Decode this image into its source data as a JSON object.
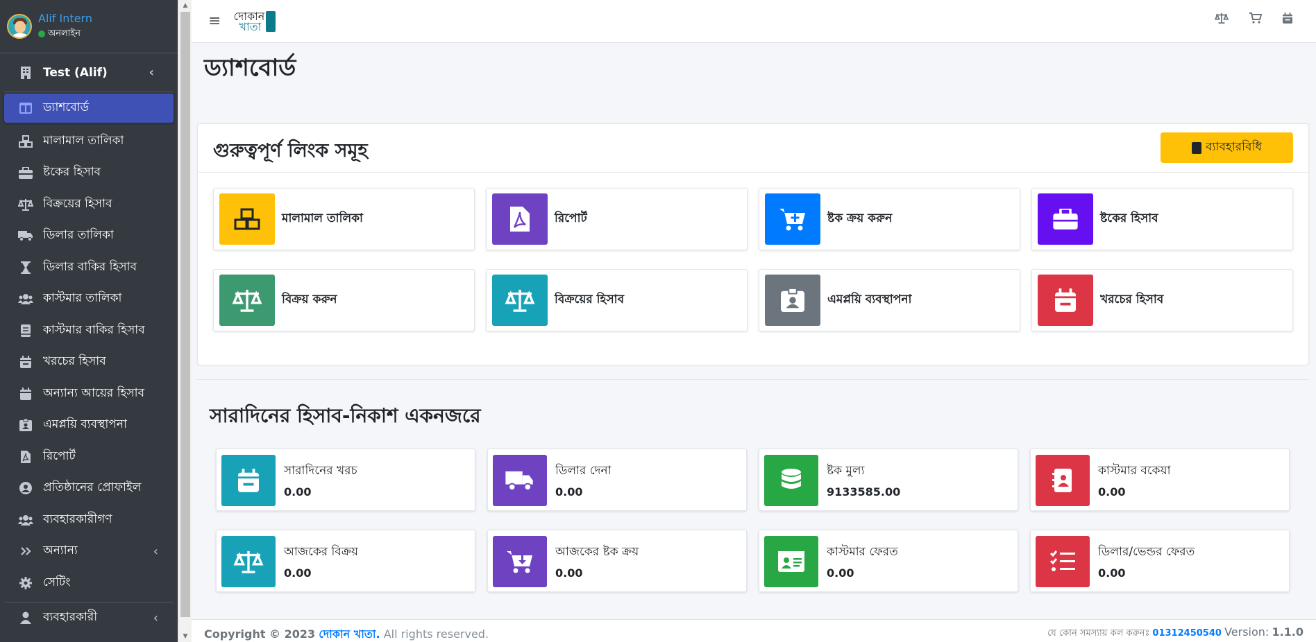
{
  "user": {
    "name": "Alif Intern",
    "status": "অনলাইন"
  },
  "sidebar": {
    "company": "Test (Alif)",
    "items": [
      {
        "label": "ড্যাশবোর্ড",
        "icon": "dashboard-icon"
      },
      {
        "label": "মালামাল তালিকা",
        "icon": "cubes-icon"
      },
      {
        "label": "ষ্টকের হিসাব",
        "icon": "briefcase-icon"
      },
      {
        "label": "বিক্রয়ের হিসাব",
        "icon": "scale-icon"
      },
      {
        "label": "ডিলার তালিকা",
        "icon": "truck-icon"
      },
      {
        "label": "ডিলার বাকির হিসাব",
        "icon": "hourglass-icon"
      },
      {
        "label": "কাস্টমার তালিকা",
        "icon": "users-icon"
      },
      {
        "label": "কাস্টমার বাকির হিসাব",
        "icon": "book-icon"
      },
      {
        "label": "খরচের হিসাব",
        "icon": "calendar-minus-icon"
      },
      {
        "label": "অন্যান্য আয়ের হিসাব",
        "icon": "calendar-icon"
      },
      {
        "label": "এমপ্লয়ি ব্যবস্থাপনা",
        "icon": "id-badge-icon"
      },
      {
        "label": "রিপোর্ট",
        "icon": "file-pdf-icon"
      },
      {
        "label": "প্রতিষ্ঠানের প্রোফাইল",
        "icon": "user-circle-icon"
      },
      {
        "label": "ব্যবহারকারীগণ",
        "icon": "users-icon"
      },
      {
        "label": "অন্যান্য",
        "icon": "angle-double-right-icon"
      },
      {
        "label": "সেটিং",
        "icon": "gear-icon"
      }
    ],
    "bottom": "ব্যবহারকারী"
  },
  "header": {
    "logo_line1": "দোকান",
    "logo_line2": "খাতা"
  },
  "page_title": "ড্যাশবোর্ড",
  "links_section": {
    "title": "গুরুত্বপূর্ণ লিংক সমূহ",
    "guide_button": "ব্যাবহারবিধি",
    "links": [
      {
        "label": "মালামাল তালিকা",
        "color": "#ffc107",
        "icon": "cubes-icon"
      },
      {
        "label": "রিপোর্ট",
        "color": "#6f42c1",
        "icon": "file-pdf-icon"
      },
      {
        "label": "ষ্টক ক্রয় করুন",
        "color": "#007bff",
        "icon": "cart-plus-icon"
      },
      {
        "label": "ষ্টকের হিসাব",
        "color": "#6610f2",
        "icon": "briefcase-icon"
      },
      {
        "label": "বিক্রয় করুন",
        "color": "#3d9970",
        "icon": "scale-icon"
      },
      {
        "label": "বিক্রয়ের হিসাব",
        "color": "#17a2b8",
        "icon": "scale-icon"
      },
      {
        "label": "এমপ্লয়ি ব্যবস্থাপনা",
        "color": "#6c757d",
        "icon": "id-badge-icon"
      },
      {
        "label": "খরচের হিসাব",
        "color": "#dc3545",
        "icon": "calendar-minus-icon"
      }
    ]
  },
  "summary": {
    "title": "সারাদিনের হিসাব-নিকাশ একনজরে",
    "cards": [
      {
        "label": "সারাদিনের খরচ",
        "value": "0.00",
        "color": "#17a2b8",
        "icon": "calendar-minus-icon"
      },
      {
        "label": "ডিলার দেনা",
        "value": "0.00",
        "color": "#6f42c1",
        "icon": "truck-icon"
      },
      {
        "label": "ষ্টক মুল্য",
        "value": "9133585.00",
        "color": "#28a745",
        "icon": "database-icon"
      },
      {
        "label": "কাস্টমার বকেয়া",
        "value": "0.00",
        "color": "#dc3545",
        "icon": "address-book-icon"
      },
      {
        "label": "আজকের বিক্রয়",
        "value": "0.00",
        "color": "#17a2b8",
        "icon": "scale-icon"
      },
      {
        "label": "আজকের ষ্টক ক্রয়",
        "value": "0.00",
        "color": "#6f42c1",
        "icon": "cart-download-icon"
      },
      {
        "label": "কাস্টমার ফেরত",
        "value": "0.00",
        "color": "#28a745",
        "icon": "id-card-icon"
      },
      {
        "label": "ডিলার/ভেন্ডর ফেরত",
        "value": "0.00",
        "color": "#dc3545",
        "icon": "tasks-icon"
      }
    ]
  },
  "footer": {
    "copyright": "Copyright © 2023",
    "brand": "দোকান খাতা.",
    "rights": "All rights reserved.",
    "help_text": "যে কোন সমস্যায় কল করুনঃ",
    "phone": "01312450540",
    "version_label": "Version:",
    "version": "1.1.0"
  }
}
